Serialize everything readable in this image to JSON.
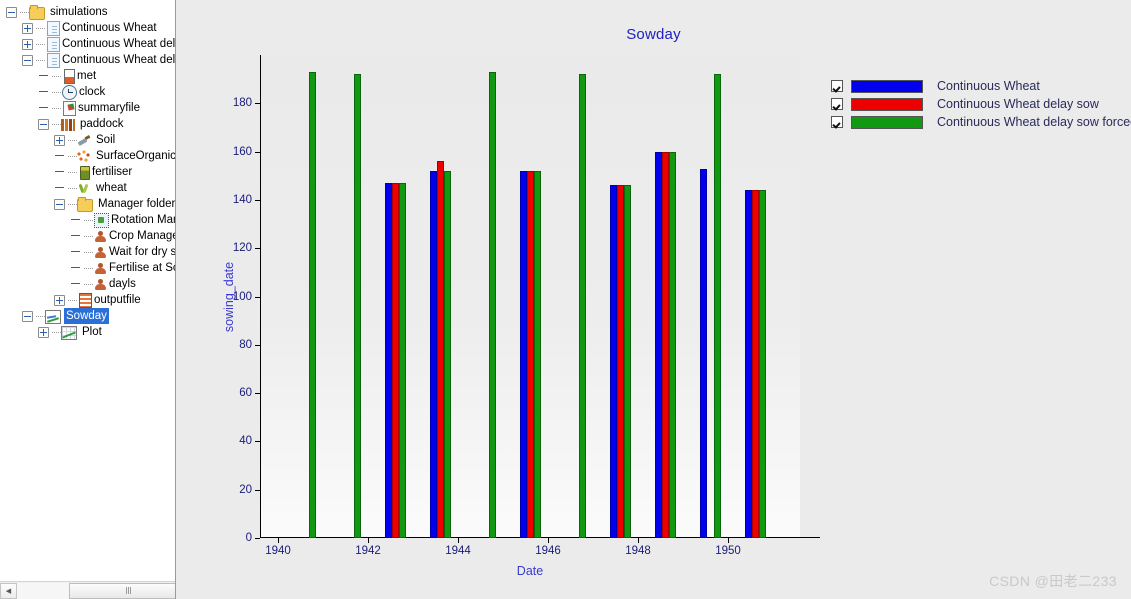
{
  "tree": {
    "items": [
      {
        "label": "simulations",
        "depth": 0,
        "icon": "folder-icon",
        "expander": "minus",
        "selected": false
      },
      {
        "label": "Continuous Wheat",
        "depth": 1,
        "icon": "document-icon",
        "expander": "plus",
        "selected": false
      },
      {
        "label": "Continuous Wheat delay s",
        "depth": 1,
        "icon": "document-icon",
        "expander": "plus",
        "selected": false
      },
      {
        "label": "Continuous Wheat delay s",
        "depth": 1,
        "icon": "document-icon",
        "expander": "minus",
        "selected": false
      },
      {
        "label": "met",
        "depth": 2,
        "icon": "met-icon",
        "expander": "none",
        "selected": false
      },
      {
        "label": "clock",
        "depth": 2,
        "icon": "clock-icon",
        "expander": "none",
        "selected": false
      },
      {
        "label": "summaryfile",
        "depth": 2,
        "icon": "summaryfile-icon",
        "expander": "none",
        "selected": false
      },
      {
        "label": "paddock",
        "depth": 2,
        "icon": "paddock-icon",
        "expander": "minus",
        "selected": false
      },
      {
        "label": "Soil",
        "depth": 3,
        "icon": "soil-icon",
        "expander": "plus",
        "selected": false
      },
      {
        "label": "SurfaceOrganicMa",
        "depth": 3,
        "icon": "surface-organic-matter-icon",
        "expander": "none",
        "selected": false
      },
      {
        "label": "fertiliser",
        "depth": 3,
        "icon": "fertiliser-icon",
        "expander": "none",
        "selected": false
      },
      {
        "label": "wheat",
        "depth": 3,
        "icon": "wheat-icon",
        "expander": "none",
        "selected": false
      },
      {
        "label": "Manager folder",
        "depth": 3,
        "icon": "folder-icon",
        "expander": "minus",
        "selected": false
      },
      {
        "label": "Rotation Mana",
        "depth": 4,
        "icon": "rotation-manager-icon",
        "expander": "none",
        "selected": false
      },
      {
        "label": "Crop Managen",
        "depth": 4,
        "icon": "manager-person-icon",
        "expander": "none",
        "selected": false
      },
      {
        "label": "Wait for dry su",
        "depth": 4,
        "icon": "manager-person-icon",
        "expander": "none",
        "selected": false
      },
      {
        "label": "Fertilise at Sow",
        "depth": 4,
        "icon": "manager-person-icon",
        "expander": "none",
        "selected": false
      },
      {
        "label": "dayls",
        "depth": 4,
        "icon": "manager-person-icon",
        "expander": "none",
        "selected": false
      },
      {
        "label": "outputfile",
        "depth": 3,
        "icon": "outputfile-icon",
        "expander": "plus",
        "selected": false
      },
      {
        "label": "Sowday",
        "depth": 1,
        "icon": "chart-icon",
        "expander": "minus",
        "selected": true
      },
      {
        "label": "Plot",
        "depth": 2,
        "icon": "plot-icon",
        "expander": "plus",
        "selected": false
      }
    ],
    "scrollbar": {
      "left_arrow": "◀",
      "right_arrow": "▶"
    }
  },
  "chart_data": {
    "type": "bar",
    "title": "Sowday",
    "xlabel": "Date",
    "ylabel": "sowing_date",
    "ylim": [
      0,
      200
    ],
    "yticks": [
      0,
      20,
      40,
      60,
      80,
      100,
      120,
      140,
      160,
      180
    ],
    "xticks": [
      1940,
      1942,
      1944,
      1946,
      1948,
      1950
    ],
    "xlim": [
      1939.6,
      1951.6
    ],
    "grid": false,
    "legend_position": "right",
    "series": [
      {
        "name": "Continuous Wheat",
        "color": "#0000ee",
        "checked": true,
        "values": [
          null,
          null,
          147,
          152,
          null,
          152,
          null,
          146,
          160,
          153,
          144
        ]
      },
      {
        "name": "Continuous Wheat delay sow",
        "color": "#ee0000",
        "checked": true,
        "values": [
          null,
          null,
          147,
          156,
          null,
          152,
          null,
          146,
          160,
          null,
          144
        ]
      },
      {
        "name": "Continuous Wheat delay sow forced",
        "color": "#119911",
        "checked": true,
        "values": [
          193,
          192,
          147,
          152,
          193,
          152,
          192,
          146,
          160,
          192,
          144
        ]
      }
    ],
    "x": [
      1940.6,
      1941.6,
      1942.6,
      1943.6,
      1944.6,
      1945.6,
      1946.6,
      1947.6,
      1948.6,
      1949.6,
      1950.6
    ]
  },
  "watermark": "CSDN @田老二233"
}
